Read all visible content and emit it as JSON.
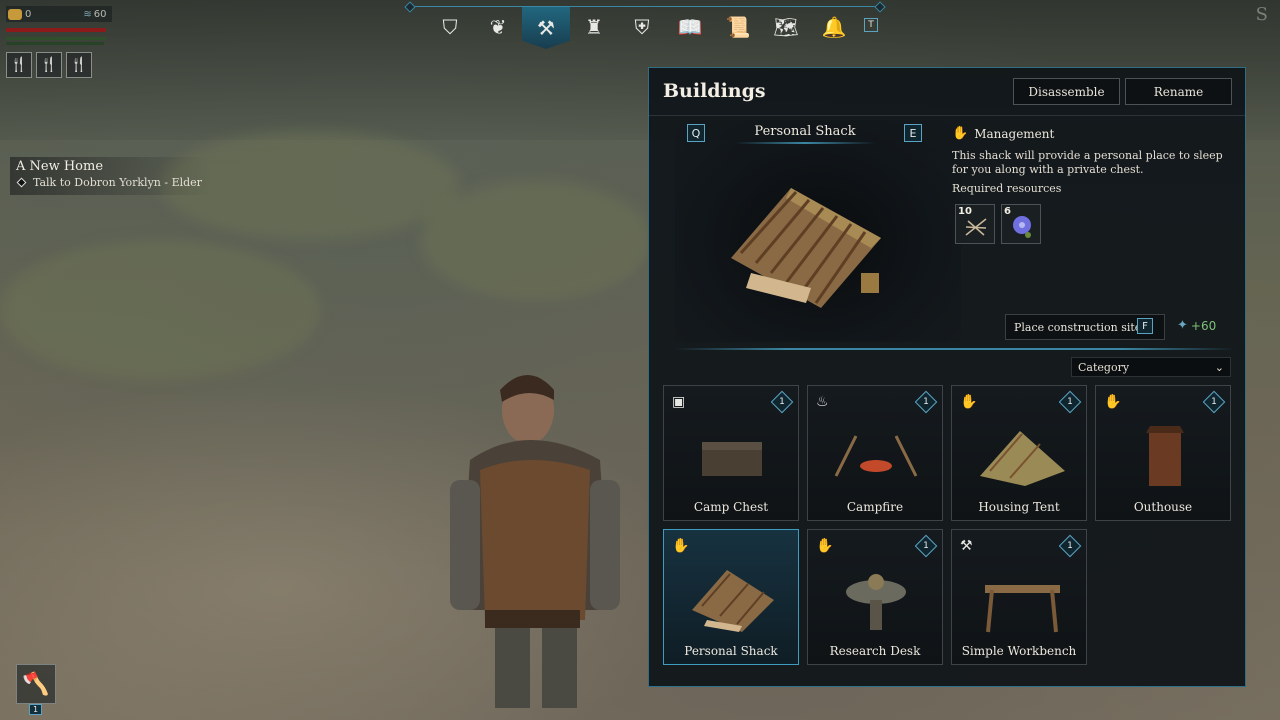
{
  "hud": {
    "coins": "0",
    "water": "60",
    "food_slot_icon": "fork-knife-icon"
  },
  "quest": {
    "title": "A New Home",
    "task": "Talk to Dobron Yorklyn - Elder"
  },
  "topnav": {
    "items": [
      {
        "name": "banner-icon",
        "glyph": "⛉"
      },
      {
        "name": "map-scroll-icon",
        "glyph": "❦"
      },
      {
        "name": "hammer-icon",
        "glyph": "⚒"
      },
      {
        "name": "castle-icon",
        "glyph": "♜"
      },
      {
        "name": "helmet-icon",
        "glyph": "⛨"
      },
      {
        "name": "book-icon",
        "glyph": "📖"
      },
      {
        "name": "scroll-icon",
        "glyph": "📜"
      },
      {
        "name": "quest-map-icon",
        "glyph": "🗺"
      },
      {
        "name": "bell-icon",
        "glyph": "🔔"
      }
    ],
    "active_index": 2,
    "key_hint": "T"
  },
  "corner_letter": "S",
  "toolbar_slot": {
    "icon": "axe-icon",
    "count": "1"
  },
  "panel": {
    "title": "Buildings",
    "disassemble_label": "Disassemble",
    "rename_label": "Rename",
    "selected": {
      "key_prev": "Q",
      "key_next": "E",
      "name": "Personal Shack",
      "category": "Management",
      "description": "This shack will provide a personal place to sleep for you along with a private chest.",
      "required_label": "Required resources",
      "resources": [
        {
          "name": "sticks",
          "qty": "10"
        },
        {
          "name": "flax-flower",
          "qty": "6"
        }
      ],
      "place_label": "Place construction site",
      "place_key": "F",
      "xp": "+60"
    },
    "category_select": "Category",
    "buildings": [
      {
        "name": "Camp Chest",
        "icon": "storage-icon",
        "badge": "1",
        "selected": false
      },
      {
        "name": "Campfire",
        "icon": "cooking-icon",
        "badge": "1",
        "selected": false
      },
      {
        "name": "Housing Tent",
        "icon": "management-icon",
        "badge": "1",
        "selected": false
      },
      {
        "name": "Outhouse",
        "icon": "management-icon",
        "badge": "1",
        "selected": false
      },
      {
        "name": "Personal Shack",
        "icon": "management-icon",
        "badge": "",
        "selected": true
      },
      {
        "name": "Research Desk",
        "icon": "management-icon",
        "badge": "1",
        "selected": false
      },
      {
        "name": "Simple Workbench",
        "icon": "crafting-icon",
        "badge": "1",
        "selected": false
      }
    ]
  }
}
